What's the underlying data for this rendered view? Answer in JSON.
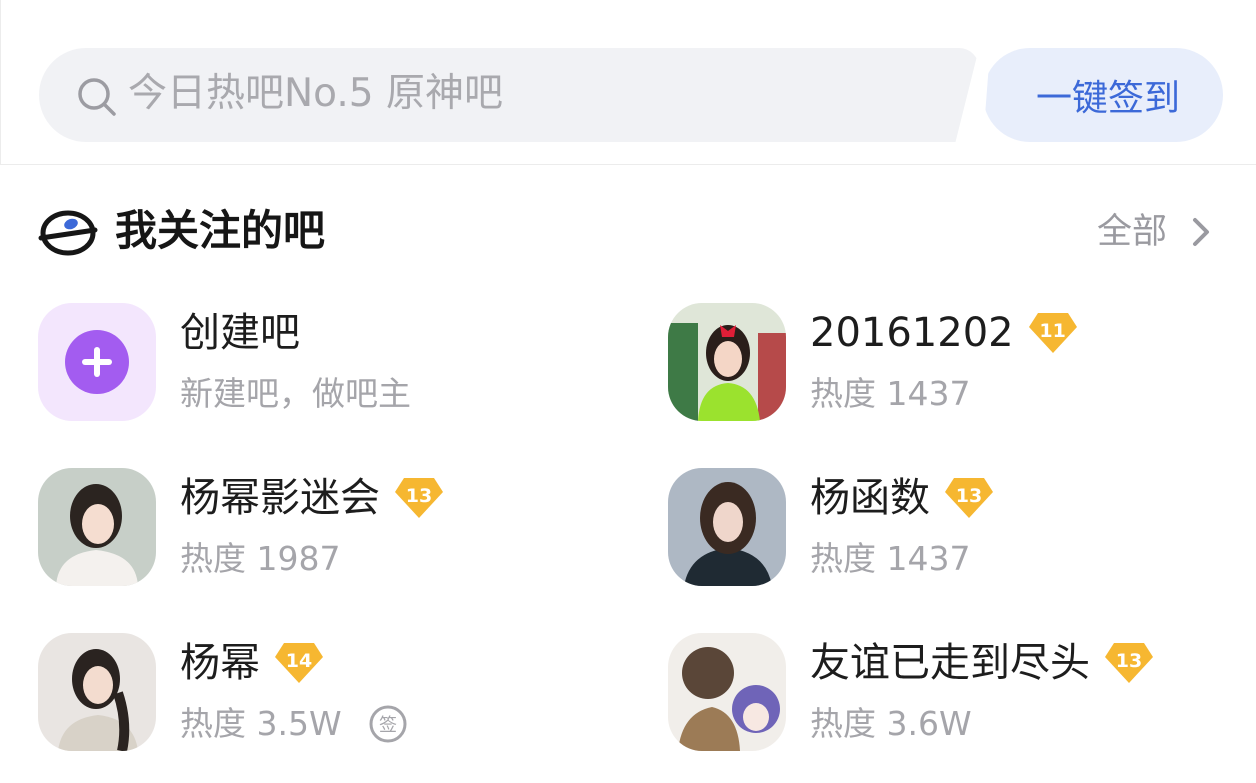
{
  "search": {
    "placeholder": "今日热吧No.5 原神吧",
    "signin_label": "一键签到"
  },
  "section": {
    "title": "我关注的吧",
    "all_label": "全部"
  },
  "colors": {
    "accent_blue": "#3c69d8",
    "level_gold": "#f6b731",
    "create_purple": "#a35cf0"
  },
  "forums": [
    {
      "name": "创建吧",
      "sub": "新建吧，做吧主",
      "level": "",
      "avatar": "plus-icon"
    },
    {
      "name": "20161202",
      "sub": "热度 1437",
      "level": "11",
      "avatar": "avatar"
    },
    {
      "name": "杨幂影迷会",
      "sub": "热度 1987",
      "level": "13",
      "avatar": "avatar"
    },
    {
      "name": "杨函数",
      "sub": "热度 1437",
      "level": "13",
      "avatar": "avatar"
    },
    {
      "name": "杨幂",
      "sub": "热度 3.5W",
      "level": "14",
      "avatar": "avatar",
      "signed_icon": "signed-in-icon"
    },
    {
      "name": "友谊已走到尽头",
      "sub": "热度 3.6W",
      "level": "13",
      "avatar": "avatar"
    }
  ]
}
